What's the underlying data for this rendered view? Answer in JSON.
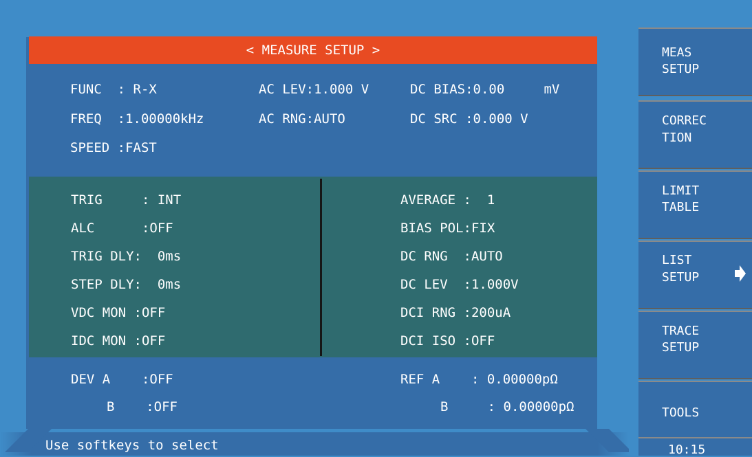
{
  "title": "< MEASURE SETUP >",
  "top_section": [
    {
      "text": "FUNC  : R-X"
    },
    {
      "text": "AC LEV:1.000 V"
    },
    {
      "text": "DC BIAS:0.00     mV"
    },
    {
      "text": "FREQ  :1.00000kHz"
    },
    {
      "text": "AC RNG:AUTO"
    },
    {
      "text": "DC SRC :0.000 V"
    },
    {
      "text": "SPEED :FAST"
    }
  ],
  "left_mid": [
    {
      "text": "TRIG     : INT"
    },
    {
      "text": "ALC      :OFF"
    },
    {
      "text": "TRIG DLY:  0ms"
    },
    {
      "text": "STEP DLY:  0ms"
    },
    {
      "text": "VDC MON :OFF"
    },
    {
      "text": "IDC MON :OFF"
    }
  ],
  "right_mid": [
    {
      "text": "AVERAGE :  1"
    },
    {
      "text": "BIAS POL:FIX"
    },
    {
      "text": "DC RNG  :AUTO"
    },
    {
      "text": "DC LEV  :1.000V"
    },
    {
      "text": "DCI RNG :200uA"
    },
    {
      "text": "DCI ISO :OFF"
    }
  ],
  "bottom_left": [
    {
      "text": "DEV A    :OFF"
    },
    {
      "text": "B    :OFF"
    }
  ],
  "bottom_right": [
    {
      "text": "REF A    : 0.00000pΩ"
    },
    {
      "text": "B     : 0.00000pΩ"
    }
  ],
  "status": "Use softkeys to select",
  "softkeys": [
    {
      "line1": "MEAS",
      "line2": "SETUP"
    },
    {
      "line1": "CORREC",
      "line2": "TION"
    },
    {
      "line1": "LIMIT",
      "line2": "TABLE"
    },
    {
      "line1": "LIST",
      "line2": "SETUP"
    },
    {
      "line1": "TRACE",
      "line2": "SETUP"
    },
    {
      "line1": "TOOLS",
      "line2": ""
    }
  ],
  "clock": "10:15",
  "colors": {
    "title_bg": "#e84b22",
    "main_bg": "#356da8",
    "mid_bg": "#2f6b6f",
    "outer_bg": "#3f8cc8"
  },
  "icons": {
    "arrow": "right-arrow-icon"
  }
}
